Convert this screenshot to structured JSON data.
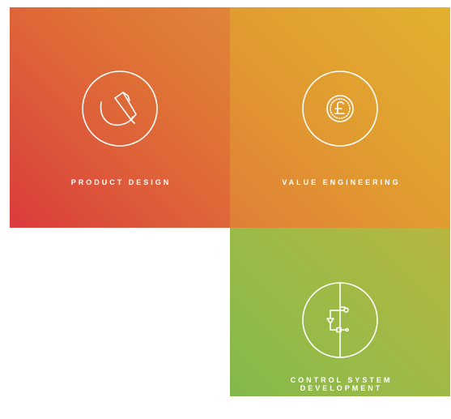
{
  "services": {
    "product_design": {
      "label": "PRODUCT DESIGN",
      "icon": "pencil-icon",
      "color_start": "#db3b3c",
      "color_end": "#e0853a"
    },
    "value_engineering": {
      "label": "VALUE ENGINEERING",
      "icon": "pound-coin-icon",
      "color_start": "#e07e36",
      "color_end": "#e2b12e"
    },
    "control_system": {
      "label_line1": "CONTROL SYSTEM",
      "label_line2": "DEVELOPMENT",
      "icon": "circuit-icon",
      "color_start": "#83b84c",
      "color_end": "#b7b63f"
    }
  }
}
